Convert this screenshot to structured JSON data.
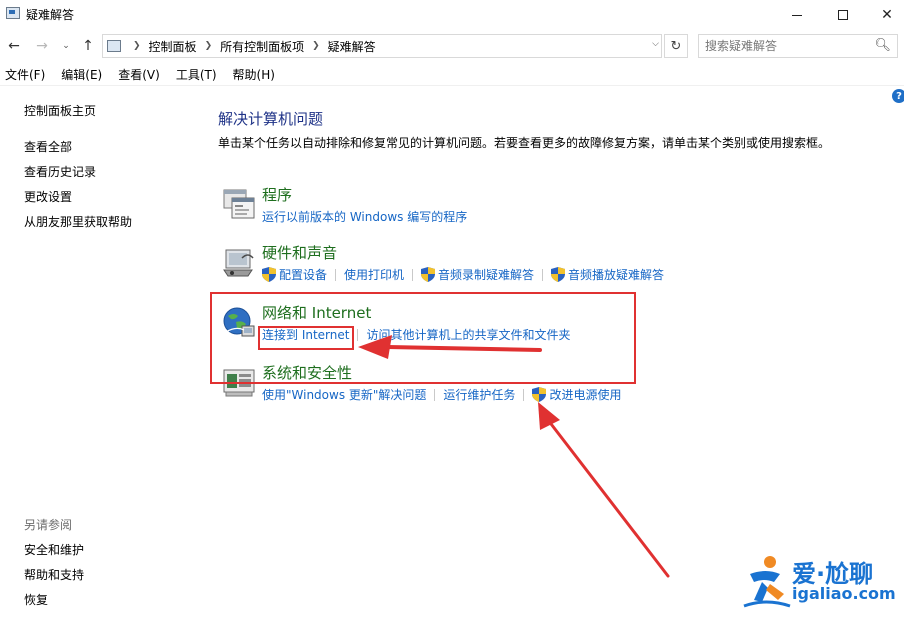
{
  "window": {
    "title": "疑难解答",
    "minimize": "—",
    "maximize": "☐",
    "close": "✕"
  },
  "nav": {
    "back": "←",
    "forward": "→",
    "recent": "⌄",
    "up": "↑",
    "breadcrumbs": [
      "控制面板",
      "所有控制面板项",
      "疑难解答"
    ],
    "refresh": "↻",
    "search_placeholder": "搜索疑难解答"
  },
  "menu": [
    "文件(F)",
    "编辑(E)",
    "查看(V)",
    "工具(T)",
    "帮助(H)"
  ],
  "left_pane": {
    "home": "控制面板主页",
    "links": [
      "查看全部",
      "查看历史记录",
      "更改设置",
      "从朋友那里获取帮助"
    ],
    "see_also_title": "另请参阅",
    "see_also": [
      "安全和维护",
      "帮助和支持",
      "恢复"
    ]
  },
  "main": {
    "title": "解决计算机问题",
    "description": "单击某个任务以自动排除和修复常见的计算机问题。若要查看更多的故障修复方案，请单击某个类别或使用搜索框。",
    "categories": [
      {
        "heading": "程序",
        "icon": "programs-icon",
        "links": [
          {
            "label": "运行以前版本的 Windows 编写的程序",
            "shield": false
          }
        ]
      },
      {
        "heading": "硬件和声音",
        "icon": "hardware-sound-icon",
        "links": [
          {
            "label": "配置设备",
            "shield": true
          },
          {
            "label": "使用打印机",
            "shield": false
          },
          {
            "label": "音频录制疑难解答",
            "shield": true
          },
          {
            "label": "音频播放疑难解答",
            "shield": true
          }
        ]
      },
      {
        "heading": "网络和 Internet",
        "icon": "network-internet-icon",
        "links": [
          {
            "label": "连接到 Internet",
            "shield": false
          },
          {
            "label": "访问其他计算机上的共享文件和文件夹",
            "shield": false
          }
        ]
      },
      {
        "heading": "系统和安全性",
        "icon": "system-security-icon",
        "links": [
          {
            "label": "使用\"Windows 更新\"解决问题",
            "shield": false
          },
          {
            "label": "运行维护任务",
            "shield": false
          },
          {
            "label": "改进电源使用",
            "shield": true
          }
        ]
      }
    ]
  },
  "help_icon": "?",
  "watermark": {
    "cn": "爱·尬聊",
    "url": "igaliao.com"
  },
  "colors": {
    "link": "#1666c5",
    "heading_green": "#1e6e1e",
    "title_blue": "#1e3287",
    "annotation_red": "#e03131"
  }
}
